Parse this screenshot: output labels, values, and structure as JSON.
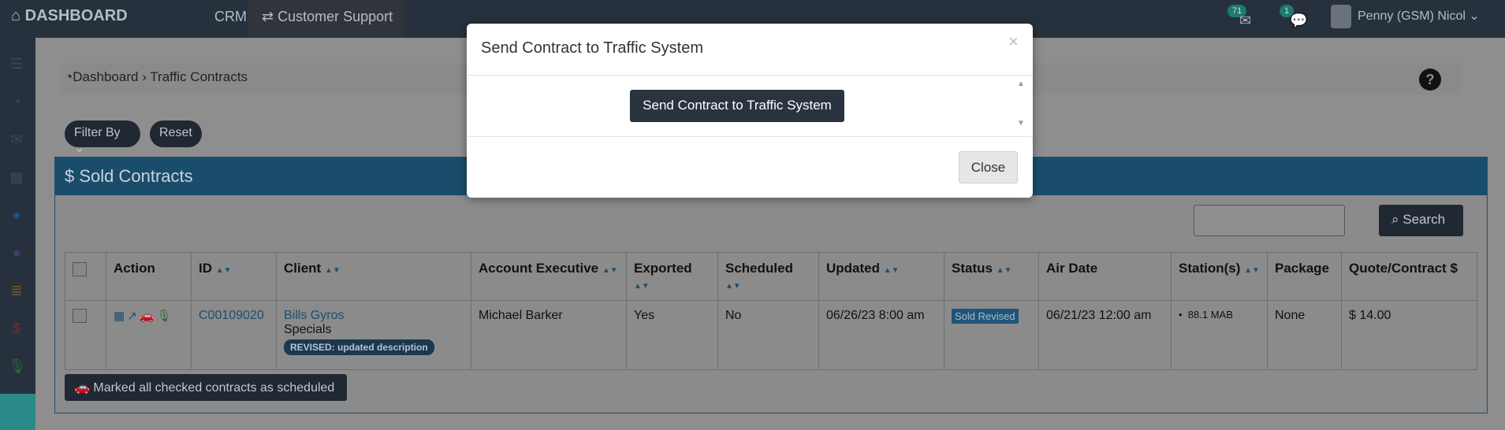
{
  "topbar": {
    "brand": "DASHBOARD",
    "nav_crm": "CRM",
    "nav_cs": "Customer Support",
    "mail_count": "71",
    "chat_count": "1",
    "user_name": "Penny (GSM) Nicol"
  },
  "breadcrumb": {
    "home": "Dashboard",
    "separator": "›",
    "current": "Traffic Contracts"
  },
  "filters": {
    "filter_by": "Filter By",
    "reset": "Reset"
  },
  "panel": {
    "title": "Sold Contracts",
    "search_placeholder": "",
    "search_label": "Search"
  },
  "table": {
    "headers": [
      "Action",
      "ID",
      "Client",
      "Account Executive",
      "Exported",
      "Scheduled",
      "Updated",
      "Status",
      "Air Date",
      "Station(s)",
      "Package",
      "Quote/Contract $"
    ],
    "rows": [
      {
        "id": "C00109020",
        "client": "Bills Gyros",
        "client_sub": "Specials",
        "revised": "REVISED: updated description",
        "account_executive": "Michael Barker",
        "exported": "Yes",
        "scheduled": "No",
        "updated": "06/26/23 8:00 am",
        "status": "Sold Revised",
        "air_date": "06/21/23 12:00 am",
        "station": "88.1 MAB",
        "package": "None",
        "amount": "$ 14.00"
      }
    ]
  },
  "mark_button": "Marked all checked contracts as scheduled",
  "modal": {
    "title": "Send Contract to Traffic System",
    "send_label": "Send Contract to Traffic System",
    "close_label": "Close",
    "close_x": "×"
  },
  "colors": {
    "accent": "#2a3440",
    "panel_header": "#3a8fc7"
  }
}
